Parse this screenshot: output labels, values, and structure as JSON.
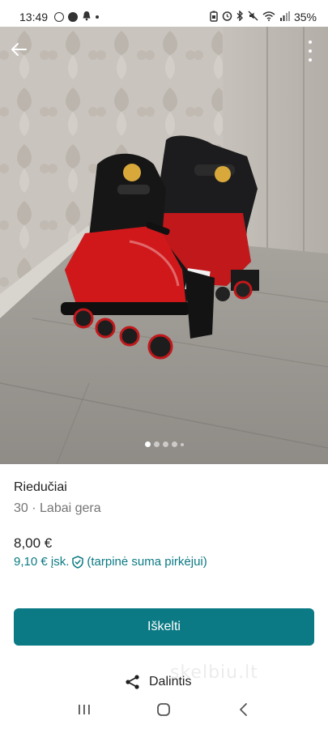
{
  "status_bar": {
    "time": "13:49",
    "battery_percent": "35%",
    "icons_left": [
      "threads-icon",
      "facebook-icon",
      "bell-icon",
      "dot"
    ],
    "icons_right": [
      "battery-saver-icon",
      "alarm-icon",
      "bluetooth-icon",
      "mute-icon",
      "wifi-icon",
      "signal-icon"
    ]
  },
  "gallery": {
    "image_count": 5,
    "active_index": 0
  },
  "listing": {
    "title": "Riedučiai",
    "subtitle": "30 · Labai gera",
    "price": "8,00 €",
    "buyer_price": "9,10 €  įsk.",
    "buyer_price_note": "(tarpinė suma pirkėjui)"
  },
  "actions": {
    "primary_label": "Iškelti",
    "share_label": "Dalintis"
  },
  "watermark": "skelbiu.lt",
  "colors": {
    "accent": "#0b7a84",
    "text": "#1f1f1f",
    "muted": "#757575"
  }
}
